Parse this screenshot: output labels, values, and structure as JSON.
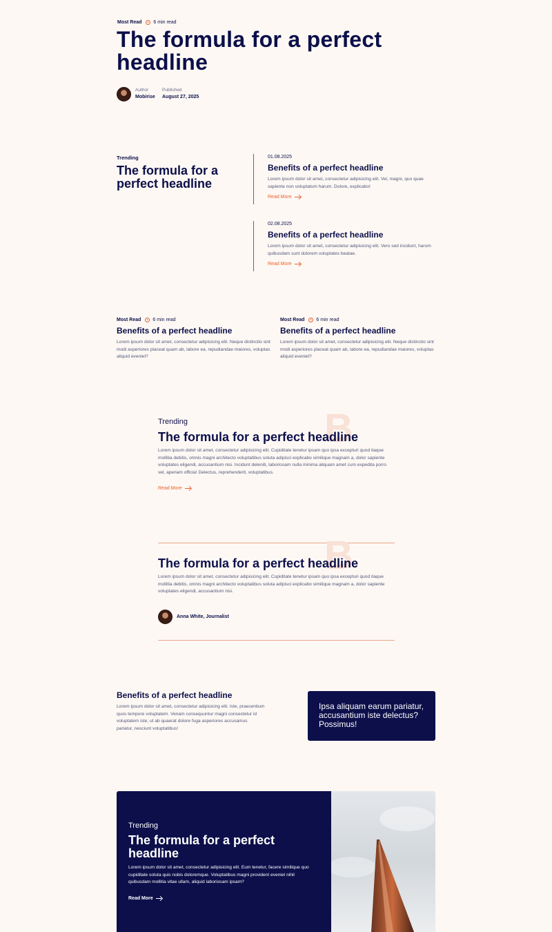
{
  "hero": {
    "category": "Most Read",
    "read_time": "6 min read",
    "title": "The formula for a perfect headline",
    "author_label": "Author",
    "author_name": "Mobirise",
    "published_label": "Published",
    "published_date": "August 27, 2025"
  },
  "trending_section": {
    "label": "Trending",
    "title": "The formula for a perfect headline",
    "items": [
      {
        "date": "01.08.2025",
        "title": "Benefits of a perfect headline",
        "text": "Lorem ipsum dolor sit amet, consectetur adipisicing elit. Vel, magni, quo quae sapiente non voluptatum harum. Dolore, explicabo!",
        "link": "Read More"
      },
      {
        "date": "02.08.2025",
        "title": "Benefits of a perfect headline",
        "text": "Lorem ipsum dolor sit amet, consectetur adipisicing elit. Vero sed incidunt, harum quibusdam sunt dolorem voluptates beatae.",
        "link": "Read More"
      }
    ]
  },
  "most_read": [
    {
      "category": "Most Read",
      "read_time": "6 min read",
      "title": "Benefits of a perfect headline",
      "text": "Lorem ipsum dolor sit amet, consectetur adipisicing elit. Neque distinctio sint modi asperiores placeat quam ab, labore ea, repudiandae maiores, voluptas aliquid eveniet?"
    },
    {
      "category": "Most Read",
      "read_time": "6 min read",
      "title": "Benefits of a perfect headline",
      "text": "Lorem ipsum dolor sit amet, consectetur adipisicing elit. Neque distinctio sint modi asperiores placeat quam ab, labore ea, repudiandae maiores, voluptas aliquid eveniet?"
    }
  ],
  "feature": {
    "label": "Trending",
    "title": "The formula for a perfect headline",
    "text": "Lorem ipsum dolor sit amet, consectetur adipisicing elit. Cupiditate tenetur ipsam quo ipsa excepturi quod itaque mollitia debitis, omnis magni architecto voluptatibus soluta adipisci explicabo similique magnam a, dolor sapiente voluptates eligendi, accusantium nisi. Incidunt deleniti, laboriosam nulla minima aliquam amet cum expedita porro vel, aperiam officia! Delectus, reprehenderit, voluptatibus.",
    "link": "Read More"
  },
  "quote_block": {
    "title": "The formula for a perfect headline",
    "text": "Lorem ipsum dolor sit amet, consectetur adipisicing elit. Cupiditate tenetur ipsam quo ipsa excepturi quod itaque mollitia debitis, omnis magni architecto voluptatibus soluta adipisci explicabo similique magnam a, dolor sapiente voluptates eligendi, accusantium nisi.",
    "author": "Anna White, Journalist"
  },
  "benefits": {
    "title": "Benefits of a perfect headline",
    "text": "Lorem ipsum dolor sit amet, consectetur adipisicing elit. Iste, praesentium quos tempore voluptatem. Venam consequuntur magni consectetur id voluptatem iste, ut ab quaerat dolore fuga asperiores accusamus pariatur, nesciunt voluptatibus!",
    "quote": "Ipsa aliquam earum pariatur, accusantium iste delectus? Possimus!"
  },
  "promo": {
    "label": "Trending",
    "title": "The formula for a perfect headline",
    "text": "Lorem ipsum dolor sit amet, consectetur adipisicing elit. Eum tenetur, facere similique quo cupiditate soluta quis nobis doloremque. Voluptatibus magni provident eveniet nihil quibusdam mollitia vitae ullam, aliquid laboriosam ipsam?",
    "link": "Read More"
  },
  "colors": {
    "navy": "#0c0f4a",
    "accent": "#e8612c",
    "background": "#fdf8f4"
  }
}
